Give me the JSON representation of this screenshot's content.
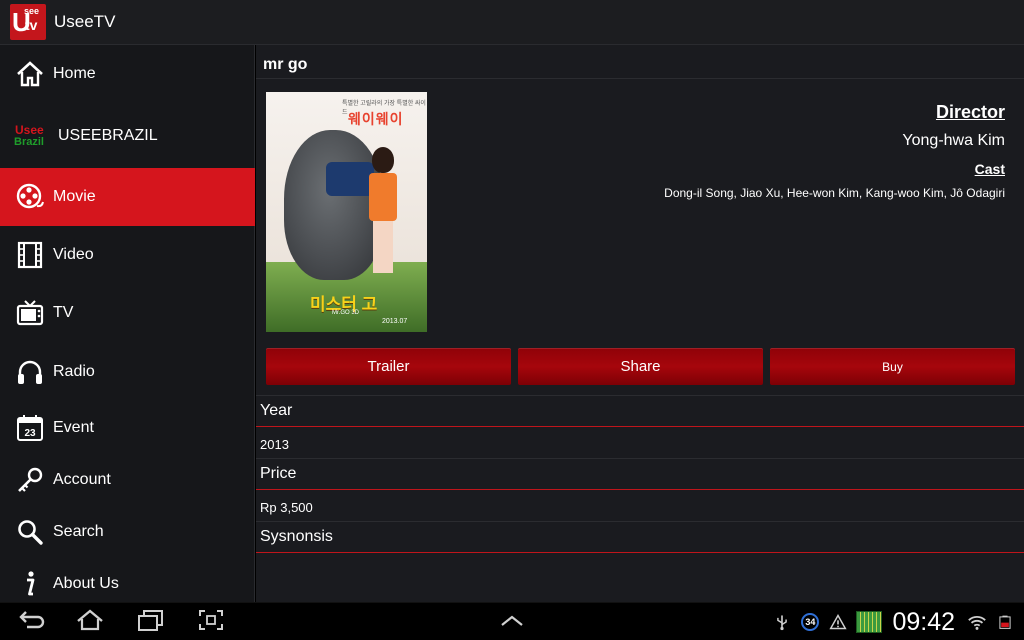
{
  "app": {
    "title": "UseeTV",
    "logo": {
      "u": "U",
      "see": "see",
      "tv": "tv"
    }
  },
  "sidebar": {
    "items": [
      {
        "label": "Home",
        "icon": "home-icon",
        "active": false
      },
      {
        "label": "USEEBRAZIL",
        "icon": "usee-brazil-logo",
        "logo_line1": "Usee",
        "logo_line2": "Brazil",
        "active": false
      },
      {
        "label": "Movie",
        "icon": "film-reel-icon",
        "active": true
      },
      {
        "label": "Video",
        "icon": "film-strip-icon",
        "active": false
      },
      {
        "label": "TV",
        "icon": "tv-icon",
        "active": false
      },
      {
        "label": "Radio",
        "icon": "headphones-icon",
        "active": false
      },
      {
        "label": "Event",
        "icon": "calendar-icon",
        "calendar_day": "23",
        "active": false
      },
      {
        "label": "Account",
        "icon": "key-icon",
        "active": false
      },
      {
        "label": "Search",
        "icon": "search-icon",
        "active": false
      },
      {
        "label": "About Us",
        "icon": "info-icon",
        "active": false
      }
    ]
  },
  "movie": {
    "title": "mr go",
    "poster": {
      "top_text_small": "특별한 고릴라의 가장 특별한 싸이드",
      "top_text": "웨이웨이",
      "bottom_title": "미스터 고",
      "bottom_sub": "Mr.GO 3D",
      "date": "2013.07"
    },
    "director_label": "Director",
    "director": "Yong-hwa Kim",
    "cast_label": "Cast",
    "cast": "Dong-il Song, Jiao Xu, Hee-won Kim, Kang-woo Kim, Jô Odagiri",
    "buttons": {
      "trailer": "Trailer",
      "share": "Share",
      "buy": "Buy"
    },
    "sections": {
      "year_label": "Year",
      "year": "2013",
      "price_label": "Price",
      "price": "Rp 3,500",
      "synopsis_label": "Sysnonsis"
    }
  },
  "status_bar": {
    "clock": "09:42",
    "notification_badge": "34"
  },
  "colors": {
    "accent": "#d5151d",
    "button": "#a6060c",
    "background": "#1a1b1f",
    "sidebar": "#16171a"
  }
}
